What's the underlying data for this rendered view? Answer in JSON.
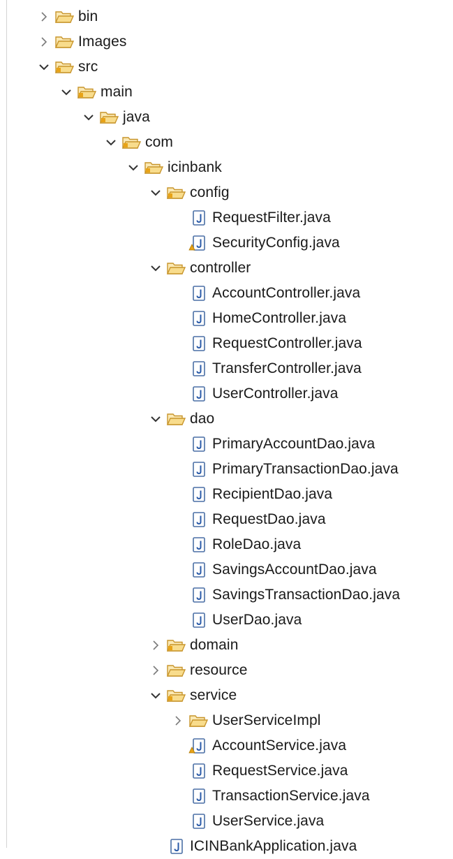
{
  "tree": [
    {
      "label": "bin",
      "level": 0,
      "kind": "folder",
      "expanded": false,
      "package": false
    },
    {
      "label": "Images",
      "level": 0,
      "kind": "folder",
      "expanded": false,
      "package": false
    },
    {
      "label": "src",
      "level": 0,
      "kind": "folder",
      "expanded": true,
      "package": true
    },
    {
      "label": "main",
      "level": 1,
      "kind": "folder",
      "expanded": true,
      "package": true
    },
    {
      "label": "java",
      "level": 2,
      "kind": "folder",
      "expanded": true,
      "package": true
    },
    {
      "label": "com",
      "level": 3,
      "kind": "folder",
      "expanded": true,
      "package": true
    },
    {
      "label": "icinbank",
      "level": 4,
      "kind": "folder",
      "expanded": true,
      "package": true
    },
    {
      "label": "config",
      "level": 5,
      "kind": "folder",
      "expanded": true,
      "package": true
    },
    {
      "label": "RequestFilter.java",
      "level": 6,
      "kind": "java",
      "warning": false
    },
    {
      "label": "SecurityConfig.java",
      "level": 6,
      "kind": "java",
      "warning": true
    },
    {
      "label": "controller",
      "level": 5,
      "kind": "folder",
      "expanded": true,
      "package": false
    },
    {
      "label": "AccountController.java",
      "level": 6,
      "kind": "java",
      "warning": false
    },
    {
      "label": "HomeController.java",
      "level": 6,
      "kind": "java",
      "warning": false
    },
    {
      "label": "RequestController.java",
      "level": 6,
      "kind": "java",
      "warning": false
    },
    {
      "label": "TransferController.java",
      "level": 6,
      "kind": "java",
      "warning": false
    },
    {
      "label": "UserController.java",
      "level": 6,
      "kind": "java",
      "warning": false
    },
    {
      "label": "dao",
      "level": 5,
      "kind": "folder",
      "expanded": true,
      "package": false
    },
    {
      "label": "PrimaryAccountDao.java",
      "level": 6,
      "kind": "java",
      "warning": false
    },
    {
      "label": "PrimaryTransactionDao.java",
      "level": 6,
      "kind": "java",
      "warning": false
    },
    {
      "label": "RecipientDao.java",
      "level": 6,
      "kind": "java",
      "warning": false
    },
    {
      "label": "RequestDao.java",
      "level": 6,
      "kind": "java",
      "warning": false
    },
    {
      "label": "RoleDao.java",
      "level": 6,
      "kind": "java",
      "warning": false
    },
    {
      "label": "SavingsAccountDao.java",
      "level": 6,
      "kind": "java",
      "warning": false
    },
    {
      "label": "SavingsTransactionDao.java",
      "level": 6,
      "kind": "java",
      "warning": false
    },
    {
      "label": "UserDao.java",
      "level": 6,
      "kind": "java",
      "warning": false
    },
    {
      "label": "domain",
      "level": 5,
      "kind": "folder",
      "expanded": false,
      "package": true
    },
    {
      "label": "resource",
      "level": 5,
      "kind": "folder",
      "expanded": false,
      "package": false
    },
    {
      "label": "service",
      "level": 5,
      "kind": "folder",
      "expanded": true,
      "package": true
    },
    {
      "label": "UserServiceImpl",
      "level": 6,
      "kind": "folder",
      "expanded": false,
      "package": false
    },
    {
      "label": "AccountService.java",
      "level": 6,
      "kind": "java",
      "warning": true
    },
    {
      "label": "RequestService.java",
      "level": 6,
      "kind": "java",
      "warning": false
    },
    {
      "label": "TransactionService.java",
      "level": 6,
      "kind": "java",
      "warning": false
    },
    {
      "label": "UserService.java",
      "level": 6,
      "kind": "java",
      "warning": false
    },
    {
      "label": "ICINBankApplication.java",
      "level": 5,
      "kind": "java",
      "warning": false
    }
  ],
  "colors": {
    "folder_fill": "#f8dc8c",
    "folder_stroke": "#c8952c",
    "package_accent": "#e8a317",
    "java_stroke": "#4a6fa5",
    "java_letter": "#2a5aa8",
    "warning": "#e8a317",
    "chevron": "#7a7a7a"
  }
}
